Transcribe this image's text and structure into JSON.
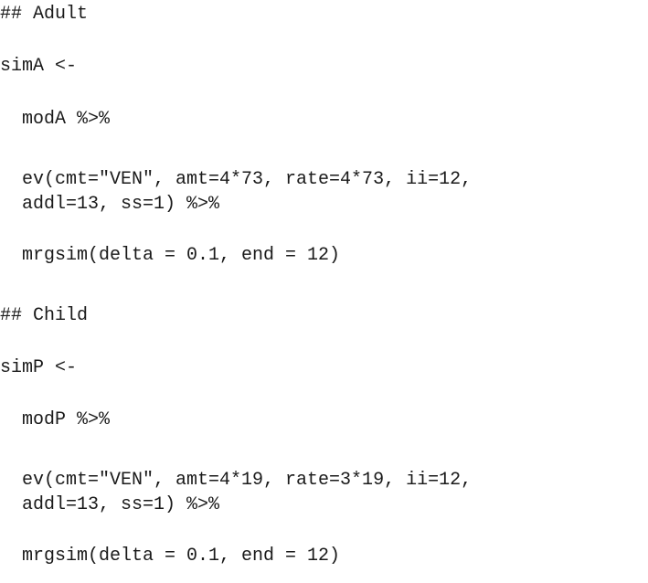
{
  "document": {
    "language": "R",
    "sections": [
      {
        "comment": "## Adult",
        "assignment": "simA <-",
        "model": "modA %>%",
        "event_line1": "ev(cmt=\"VEN\", amt=4*73, rate=4*73, ii=12,",
        "event_line2": "addl=13, ss=1) %>%",
        "sim_call": "mrgsim(delta = 0.1, end = 12)"
      },
      {
        "comment": "## Child",
        "assignment": "simP <-",
        "model": "modP %>%",
        "event_line1": "ev(cmt=\"VEN\", amt=4*19, rate=3*19, ii=12,",
        "event_line2": "addl=13, ss=1) %>%",
        "sim_call": "mrgsim(delta = 0.1, end = 12)"
      }
    ]
  }
}
